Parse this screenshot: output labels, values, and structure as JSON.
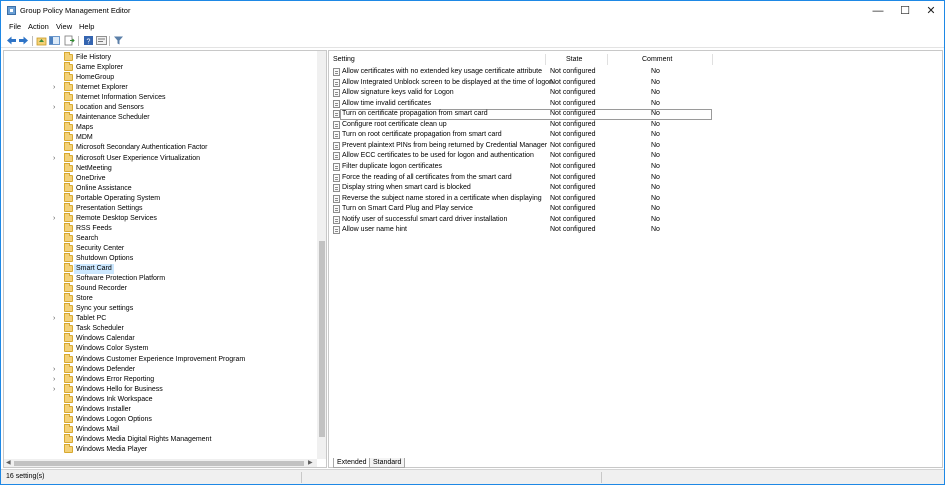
{
  "window": {
    "title": "Group Policy Management Editor",
    "controls": {
      "minimize": "—",
      "maximize": "☐",
      "close": "✕"
    }
  },
  "menu": [
    "File",
    "Action",
    "View",
    "Help"
  ],
  "toolbar": {
    "buttons": [
      "back-icon",
      "forward-icon",
      "up-folder-icon",
      "show-hide-tree-icon",
      "export-list-icon",
      "help-icon",
      "properties-icon",
      "filter-icon"
    ]
  },
  "tree": {
    "items": [
      {
        "label": "File History",
        "expandable": false
      },
      {
        "label": "Game Explorer",
        "expandable": false
      },
      {
        "label": "HomeGroup",
        "expandable": false
      },
      {
        "label": "Internet Explorer",
        "expandable": true
      },
      {
        "label": "Internet Information Services",
        "expandable": false
      },
      {
        "label": "Location and Sensors",
        "expandable": true
      },
      {
        "label": "Maintenance Scheduler",
        "expandable": false
      },
      {
        "label": "Maps",
        "expandable": false
      },
      {
        "label": "MDM",
        "expandable": false
      },
      {
        "label": "Microsoft Secondary Authentication Factor",
        "expandable": false
      },
      {
        "label": "Microsoft User Experience Virtualization",
        "expandable": true
      },
      {
        "label": "NetMeeting",
        "expandable": false
      },
      {
        "label": "OneDrive",
        "expandable": false
      },
      {
        "label": "Online Assistance",
        "expandable": false
      },
      {
        "label": "Portable Operating System",
        "expandable": false
      },
      {
        "label": "Presentation Settings",
        "expandable": false
      },
      {
        "label": "Remote Desktop Services",
        "expandable": true
      },
      {
        "label": "RSS Feeds",
        "expandable": false
      },
      {
        "label": "Search",
        "expandable": false
      },
      {
        "label": "Security Center",
        "expandable": false
      },
      {
        "label": "Shutdown Options",
        "expandable": false
      },
      {
        "label": "Smart Card",
        "expandable": false,
        "selected": true
      },
      {
        "label": "Software Protection Platform",
        "expandable": false
      },
      {
        "label": "Sound Recorder",
        "expandable": false
      },
      {
        "label": "Store",
        "expandable": false
      },
      {
        "label": "Sync your settings",
        "expandable": false
      },
      {
        "label": "Tablet PC",
        "expandable": true
      },
      {
        "label": "Task Scheduler",
        "expandable": false
      },
      {
        "label": "Windows Calendar",
        "expandable": false
      },
      {
        "label": "Windows Color System",
        "expandable": false
      },
      {
        "label": "Windows Customer Experience Improvement Program",
        "expandable": false
      },
      {
        "label": "Windows Defender",
        "expandable": true
      },
      {
        "label": "Windows Error Reporting",
        "expandable": true
      },
      {
        "label": "Windows Hello for Business",
        "expandable": true
      },
      {
        "label": "Windows Ink Workspace",
        "expandable": false
      },
      {
        "label": "Windows Installer",
        "expandable": false
      },
      {
        "label": "Windows Logon Options",
        "expandable": false
      },
      {
        "label": "Windows Mail",
        "expandable": false
      },
      {
        "label": "Windows Media Digital Rights Management",
        "expandable": false
      },
      {
        "label": "Windows Media Player",
        "expandable": false
      }
    ]
  },
  "table": {
    "headers": {
      "setting": "Setting",
      "state": "State",
      "comment": "Comment"
    },
    "rows": [
      {
        "setting": "Allow certificates with no extended key usage certificate attribute",
        "state": "Not configured",
        "comment": "No"
      },
      {
        "setting": "Allow Integrated Unblock screen to be displayed at the time of logon",
        "state": "Not configured",
        "comment": "No"
      },
      {
        "setting": "Allow signature keys valid for Logon",
        "state": "Not configured",
        "comment": "No"
      },
      {
        "setting": "Allow time invalid certificates",
        "state": "Not configured",
        "comment": "No"
      },
      {
        "setting": "Turn on certificate propagation from smart card",
        "state": "Not configured",
        "comment": "No",
        "focused": true
      },
      {
        "setting": "Configure root certificate clean up",
        "state": "Not configured",
        "comment": "No"
      },
      {
        "setting": "Turn on root certificate propagation from smart card",
        "state": "Not configured",
        "comment": "No"
      },
      {
        "setting": "Prevent plaintext PINs from being returned by Credential Manager",
        "state": "Not configured",
        "comment": "No"
      },
      {
        "setting": "Allow ECC certificates to be used for logon and authentication",
        "state": "Not configured",
        "comment": "No"
      },
      {
        "setting": "Filter duplicate logon certificates",
        "state": "Not configured",
        "comment": "No"
      },
      {
        "setting": "Force the reading of all certificates from the smart card",
        "state": "Not configured",
        "comment": "No"
      },
      {
        "setting": "Display string when smart card is blocked",
        "state": "Not configured",
        "comment": "No"
      },
      {
        "setting": "Reverse the subject name stored in a certificate when displaying",
        "state": "Not configured",
        "comment": "No"
      },
      {
        "setting": "Turn on Smart Card Plug and Play service",
        "state": "Not configured",
        "comment": "No"
      },
      {
        "setting": "Notify user of successful smart card driver installation",
        "state": "Not configured",
        "comment": "No"
      },
      {
        "setting": "Allow user name hint",
        "state": "Not configured",
        "comment": "No"
      }
    ]
  },
  "tabs": [
    "Extended",
    "Standard"
  ],
  "status": {
    "text": "16 setting(s)"
  }
}
